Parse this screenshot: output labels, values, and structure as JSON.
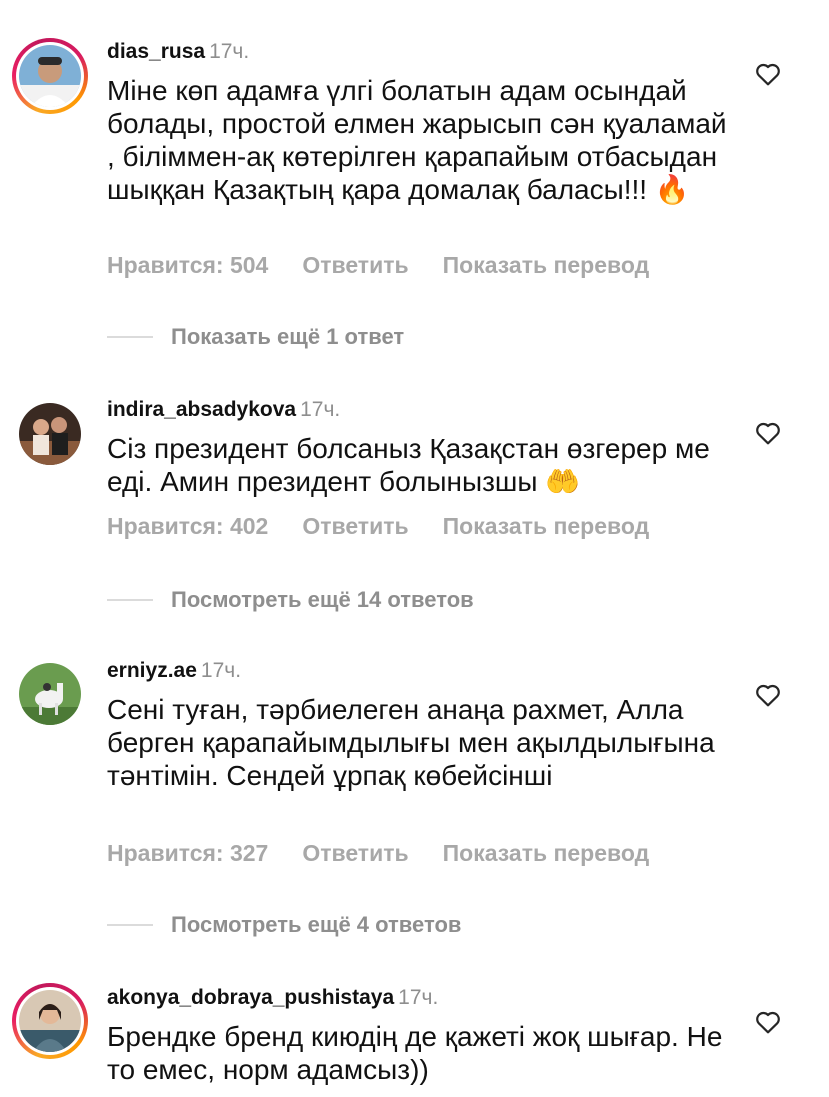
{
  "comments": [
    {
      "username": "dias_rusa",
      "time": "17ч.",
      "text": "Міне көп адамға үлгі болатын адам осындай болады, простой елмен жарысып сән қуаламай , біліммен-ақ көтерілген қарапайым отбасыдан шыққан Қазақтың қара домалақ баласы!!! ",
      "emoji": "🔥",
      "likes": "Нравится: 504",
      "reply": "Ответить",
      "translate": "Показать перевод",
      "more_replies": "Показать ещё 1 ответ"
    },
    {
      "username": "indira_absadykova",
      "time": "17ч.",
      "text": "Сіз президент болсаныз Қазақстан өзгерер ме еді. Амин президент болынызшы ",
      "emoji": "🤲",
      "likes": "Нравится: 402",
      "reply": "Ответить",
      "translate": "Показать перевод",
      "more_replies": "Посмотреть ещё 14 ответов"
    },
    {
      "username": "erniyz.ae",
      "time": "17ч.",
      "text": "Сені туған, тәрбиелеген анаңа рахмет, Алла берген қарапайымдылығы мен ақылдылығына тәнтімін. Сендей ұрпақ көбейсінші",
      "emoji": "",
      "likes": "Нравится: 327",
      "reply": "Ответить",
      "translate": "Показать перевод",
      "more_replies": "Посмотреть ещё 4 ответов"
    },
    {
      "username": "akonya_dobraya_pushistaya",
      "time": "17ч.",
      "text": "Брендке бренд киюдің де қажеті жоқ шығар. Не то емес, норм адамсыз))",
      "emoji": ""
    }
  ],
  "icons": {
    "like": "heart-outline-icon"
  },
  "colors": {
    "muted": "#8e8e8e",
    "actions": "#a8a8a8",
    "text": "#111111"
  }
}
